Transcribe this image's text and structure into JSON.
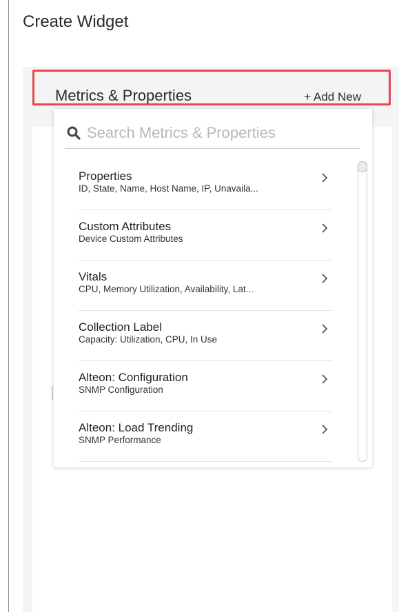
{
  "page": {
    "title": "Create Widget"
  },
  "section": {
    "title": "Metrics & Properties",
    "add_new_label": "+ Add New",
    "highlight_color": "#e8474f"
  },
  "search": {
    "placeholder": "Search Metrics & Properties",
    "value": "",
    "icon": "search-icon"
  },
  "items": [
    {
      "title": "Properties",
      "subtitle": "ID, State, Name, Host Name, IP, Unavaila..."
    },
    {
      "title": "Custom Attributes",
      "subtitle": "Device Custom Attributes"
    },
    {
      "title": "Vitals",
      "subtitle": "CPU, Memory Utilization, Availability, Lat..."
    },
    {
      "title": "Collection Label",
      "subtitle": "Capacity: Utilization, CPU, In Use"
    },
    {
      "title": "Alteon: Configuration",
      "subtitle": "SNMP Configuration"
    },
    {
      "title": "Alteon: Load Trending",
      "subtitle": "SNMP Performance"
    }
  ],
  "icons": {
    "item_action": "chevron-right-icon"
  }
}
